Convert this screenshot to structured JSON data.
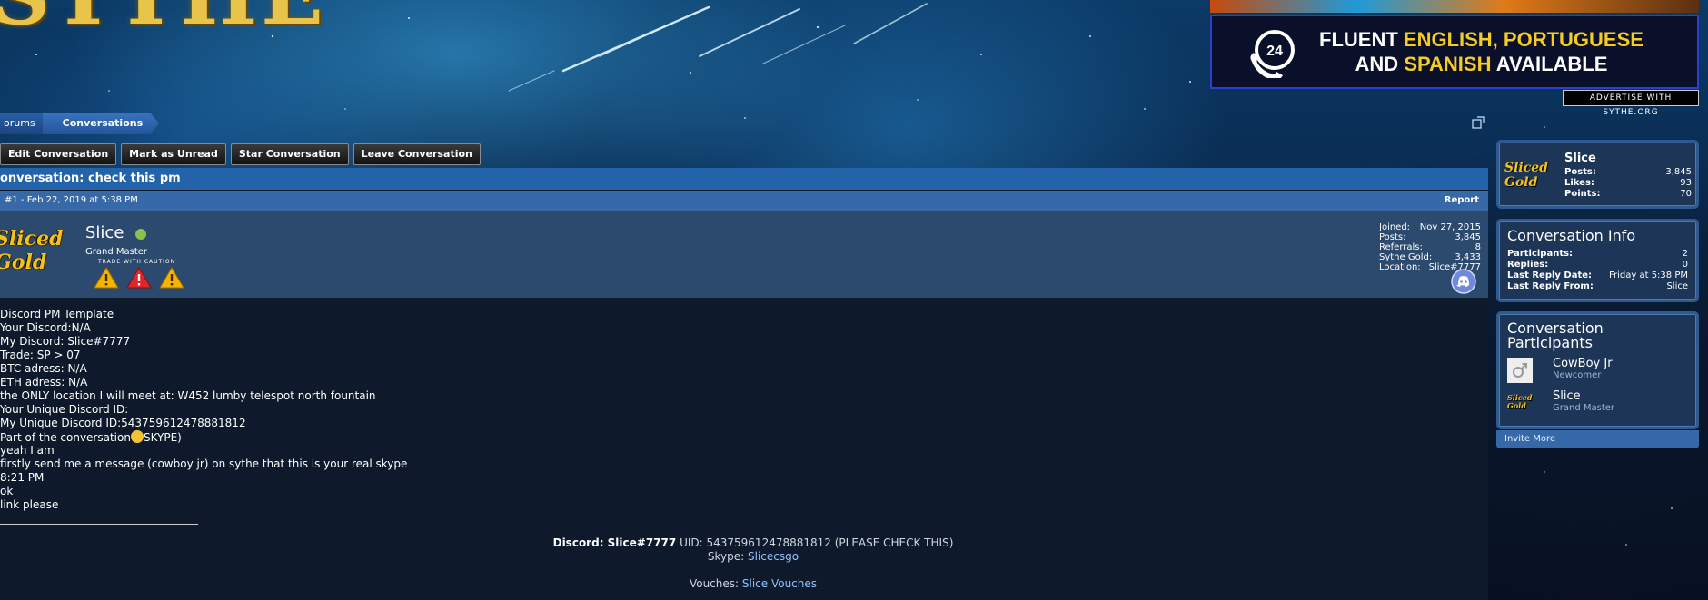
{
  "header": {
    "logo_text": "SYTHE"
  },
  "ad": {
    "badge": "24",
    "line1_a": "FLUENT ",
    "line1_b": "ENGLISH, PORTUGUESE",
    "line2_a": "AND ",
    "line2_b": "SPANISH",
    "line2_c": " AVAILABLE",
    "advertise": "ADVERTISE WITH SYTHE.ORG"
  },
  "breadcrumb": {
    "items": [
      "orums",
      "Conversations"
    ]
  },
  "actions": {
    "edit": "Edit Conversation",
    "mark_unread": "Mark as Unread",
    "star": "Star Conversation",
    "leave": "Leave Conversation"
  },
  "conversation": {
    "title": "onversation: check this pm",
    "post_meta": "#1 - Feb 22, 2019 at 5:38 PM",
    "report": "Report"
  },
  "author": {
    "avatar_text": "Sliced Gold",
    "name": "Slice",
    "rank": "Grand Master",
    "trade_caution": "TRADE WITH CAUTION",
    "stats": [
      {
        "label": "Joined:",
        "value": "Nov 27, 2015"
      },
      {
        "label": "Posts:",
        "value": "3,845"
      },
      {
        "label": "Referrals:",
        "value": "8"
      },
      {
        "label": "Sythe Gold:",
        "value": "3,433"
      },
      {
        "label": "Location:",
        "value": "Slice#7777"
      }
    ]
  },
  "body": {
    "lines": [
      "Discord PM Template",
      "Your Discord:N/A",
      "My Discord: Slice#7777",
      "Trade: SP > 07",
      "BTC adress: N/A",
      "ETH adress: N/A",
      "the ONLY location I will meet at: W452 lumby telespot north fountain",
      "Your Unique Discord ID:",
      "My Unique Discord ID:543759612478881812",
      "Part of the conversation",
      "yeah I am",
      "firstly send me a message (cowboy jr) on sythe that this is your real skype",
      "8:21 PM",
      "ok",
      "link please"
    ],
    "line9_tail": "SKYPE)"
  },
  "signature": {
    "discord_label": "Discord: Slice#7777",
    "uid": " UID: 543759612478881812 (PLEASE CHECK THIS)",
    "skype_label": "Skype: ",
    "skype_link": "Slicecsgo",
    "vouches_label": "Vouches: ",
    "vouches_link": "Slice Vouches"
  },
  "sidebar": {
    "user": {
      "avatar_text": "Sliced Gold",
      "name": "Slice",
      "stats": [
        {
          "label": "Posts:",
          "value": "3,845"
        },
        {
          "label": "Likes:",
          "value": "93"
        },
        {
          "label": "Points:",
          "value": "70"
        }
      ]
    },
    "info": {
      "title": "Conversation Info",
      "rows": [
        {
          "label": "Participants:",
          "value": "2"
        },
        {
          "label": "Replies:",
          "value": "0"
        },
        {
          "label": "Last Reply Date:",
          "value": "Friday at 5:38 PM"
        },
        {
          "label": "Last Reply From:",
          "value": "Slice"
        }
      ]
    },
    "participants": {
      "title_1": "Conversation",
      "title_2": "Participants",
      "list": [
        {
          "name": "CowBoy Jr",
          "rank": "Newcomer"
        },
        {
          "name": "Slice",
          "rank": "Grand Master"
        }
      ],
      "invite": "Invite More"
    }
  },
  "colors": {
    "accent": "#2363a9",
    "link": "#8fc2ff",
    "gold": "#f3c21a",
    "online": "#8bc34a"
  }
}
